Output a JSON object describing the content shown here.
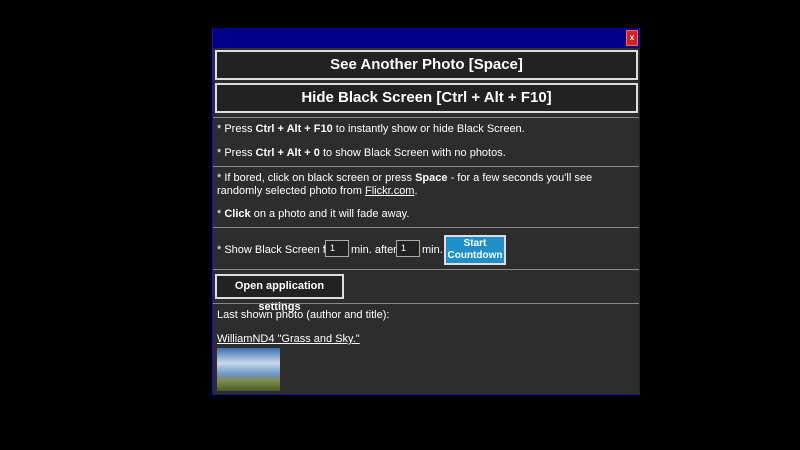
{
  "close_label": "x",
  "buttons": {
    "another_photo": "See Another Photo [Space]",
    "hide": "Hide Black Screen [Ctrl + Alt + F10]",
    "start_line1": "Start",
    "start_line2": "Countdown",
    "settings": "Open application settings"
  },
  "tips": {
    "t1_pre": "* Press ",
    "t1_bold": "Ctrl + Alt + F10",
    "t1_post": " to instantly show or hide Black Screen.",
    "t2_pre": "* Press ",
    "t2_bold": "Ctrl + Alt + 0",
    "t2_post": " to show Black Screen with no photos.",
    "t3_pre": "* If bored, click on black screen or press ",
    "t3_bold": "Space",
    "t3_mid": " - for a few seconds you'll see randomly selected photo from ",
    "t3_link": "Flickr.com",
    "t3_end": ".",
    "t4_pre": "* ",
    "t4_bold": "Click",
    "t4_post": " on a photo and it will fade away."
  },
  "countdown": {
    "pre": "* Show Black Screen for",
    "duration": "1",
    "mid": "min. after",
    "delay": "1",
    "post": "min."
  },
  "last_photo": {
    "label": "Last shown photo (author and title):",
    "link": "WilliamND4 \"Grass and Sky.\""
  }
}
